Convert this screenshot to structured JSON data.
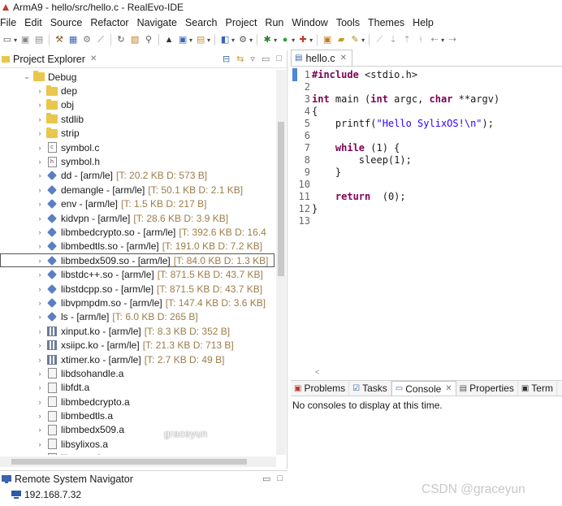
{
  "window": {
    "title": "ArmA9 - hello/src/hello.c - RealEvo-IDE"
  },
  "menubar": [
    "File",
    "Edit",
    "Source",
    "Refactor",
    "Navigate",
    "Search",
    "Project",
    "Run",
    "Window",
    "Tools",
    "Themes",
    "Help"
  ],
  "project_explorer": {
    "title": "Project Explorer",
    "items": [
      {
        "label": "Debug",
        "meta": "",
        "type": "folder-open",
        "indent": 1
      },
      {
        "label": "dep",
        "meta": "",
        "type": "folder",
        "indent": 2
      },
      {
        "label": "obj",
        "meta": "",
        "type": "folder",
        "indent": 2
      },
      {
        "label": "stdlib",
        "meta": "",
        "type": "folder",
        "indent": 2
      },
      {
        "label": "strip",
        "meta": "",
        "type": "folder",
        "indent": 2
      },
      {
        "label": "symbol.c",
        "meta": "",
        "type": "cfile",
        "indent": 2
      },
      {
        "label": "symbol.h",
        "meta": "",
        "type": "hfile",
        "indent": 2
      },
      {
        "label": "dd - [arm/le]",
        "meta": "[T: 20.2 KB  D: 573 B]",
        "type": "bin",
        "indent": 2
      },
      {
        "label": "demangle - [arm/le]",
        "meta": "[T: 50.1 KB  D: 2.1 KB]",
        "type": "bin",
        "indent": 2
      },
      {
        "label": "env - [arm/le]",
        "meta": "[T: 1.5 KB  D: 217 B]",
        "type": "bin",
        "indent": 2
      },
      {
        "label": "kidvpn - [arm/le]",
        "meta": "[T: 28.6 KB  D: 3.9 KB]",
        "type": "bin",
        "indent": 2
      },
      {
        "label": "libmbedcrypto.so - [arm/le]",
        "meta": "[T: 392.6 KB  D: 16.4",
        "type": "bin",
        "indent": 2
      },
      {
        "label": "libmbedtls.so - [arm/le]",
        "meta": "[T: 191.0 KB  D: 7.2 KB]",
        "type": "bin",
        "indent": 2
      },
      {
        "label": "libmbedx509.so - [arm/le]",
        "meta": "[T: 84.0 KB  D: 1.3 KB]",
        "type": "bin",
        "indent": 2,
        "selected": true
      },
      {
        "label": "libstdc++.so - [arm/le]",
        "meta": "[T: 871.5 KB  D: 43.7 KB]",
        "type": "bin",
        "indent": 2
      },
      {
        "label": "libstdcpp.so - [arm/le]",
        "meta": "[T: 871.5 KB  D: 43.7 KB]",
        "type": "bin",
        "indent": 2
      },
      {
        "label": "libvpmpdm.so - [arm/le]",
        "meta": "[T: 147.4 KB  D: 3.6 KB]",
        "type": "bin",
        "indent": 2
      },
      {
        "label": "ls - [arm/le]",
        "meta": "[T: 6.0 KB  D: 265 B]",
        "type": "bin",
        "indent": 2
      },
      {
        "label": "xinput.ko - [arm/le]",
        "meta": "[T: 8.3 KB  D: 352 B]",
        "type": "ko",
        "indent": 2
      },
      {
        "label": "xsiipc.ko - [arm/le]",
        "meta": "[T: 21.3 KB  D: 713 B]",
        "type": "ko",
        "indent": 2
      },
      {
        "label": "xtimer.ko - [arm/le]",
        "meta": "[T: 2.7 KB  D: 49 B]",
        "type": "ko",
        "indent": 2
      },
      {
        "label": "libdsohandle.a",
        "meta": "",
        "type": "lib",
        "indent": 2
      },
      {
        "label": "libfdt.a",
        "meta": "",
        "type": "lib",
        "indent": 2
      },
      {
        "label": "libmbedcrypto.a",
        "meta": "",
        "type": "lib",
        "indent": 2
      },
      {
        "label": "libmbedtls.a",
        "meta": "",
        "type": "lib",
        "indent": 2
      },
      {
        "label": "libmbedx509.a",
        "meta": "",
        "type": "lib",
        "indent": 2
      },
      {
        "label": "libsylixos.a",
        "meta": "",
        "type": "lib",
        "indent": 2
      },
      {
        "label": "libvpmpdm.a",
        "meta": "",
        "type": "lib",
        "indent": 2
      }
    ]
  },
  "remote_system_navigator": {
    "title": "Remote System Navigator",
    "host": "192.168.7.32"
  },
  "editor": {
    "tab": "hello.c",
    "lines": [
      {
        "n": "1",
        "text": "#include <stdio.h>"
      },
      {
        "n": "2",
        "text": ""
      },
      {
        "n": "3",
        "text": "int main (int argc, char **argv)"
      },
      {
        "n": "4",
        "text": "{"
      },
      {
        "n": "5",
        "text": "    printf(\"Hello SylixOS!\\n\");"
      },
      {
        "n": "6",
        "text": ""
      },
      {
        "n": "7",
        "text": "    while (1) {"
      },
      {
        "n": "8",
        "text": "        sleep(1);"
      },
      {
        "n": "9",
        "text": "    }"
      },
      {
        "n": "10",
        "text": ""
      },
      {
        "n": "11",
        "text": "    return  (0);"
      },
      {
        "n": "12",
        "text": "}"
      },
      {
        "n": "13",
        "text": ""
      }
    ]
  },
  "bottom_panel": {
    "tabs": [
      "Problems",
      "Tasks",
      "Console",
      "Properties",
      "Term"
    ],
    "active_tab": "Console",
    "message": "No consoles to display at this time."
  },
  "watermarks": {
    "center": "graceyun",
    "corner": "CSDN @graceyun"
  },
  "colors": {
    "accent": "#4f86d6",
    "keyword": "#7f0055",
    "string": "#2a00ff",
    "meta": "#9c7c48",
    "folder": "#e9c64c"
  }
}
